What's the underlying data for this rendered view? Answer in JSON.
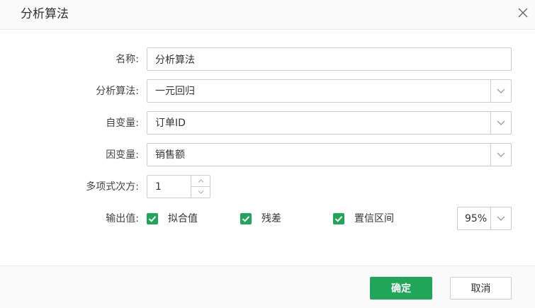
{
  "dialog": {
    "title": "分析算法",
    "close_icon": "close-icon"
  },
  "form": {
    "name": {
      "label": "名称:",
      "value": "分析算法"
    },
    "algorithm": {
      "label": "分析算法:",
      "value": "一元回归"
    },
    "independent": {
      "label": "自变量:",
      "value": "订单ID"
    },
    "dependent": {
      "label": "因变量:",
      "value": "销售额"
    },
    "polynomial": {
      "label": "多项式次方:",
      "value": "1"
    },
    "output": {
      "label": "输出值:",
      "options": [
        {
          "label": "拟合值",
          "checked": true
        },
        {
          "label": "残差",
          "checked": true
        },
        {
          "label": "置信区间",
          "checked": true
        }
      ],
      "confidence": "95%"
    }
  },
  "footer": {
    "ok_label": "确定",
    "cancel_label": "取消"
  },
  "colors": {
    "accent": "#1fa659",
    "border": "#cccccc",
    "header_bg": "#fafafa"
  }
}
